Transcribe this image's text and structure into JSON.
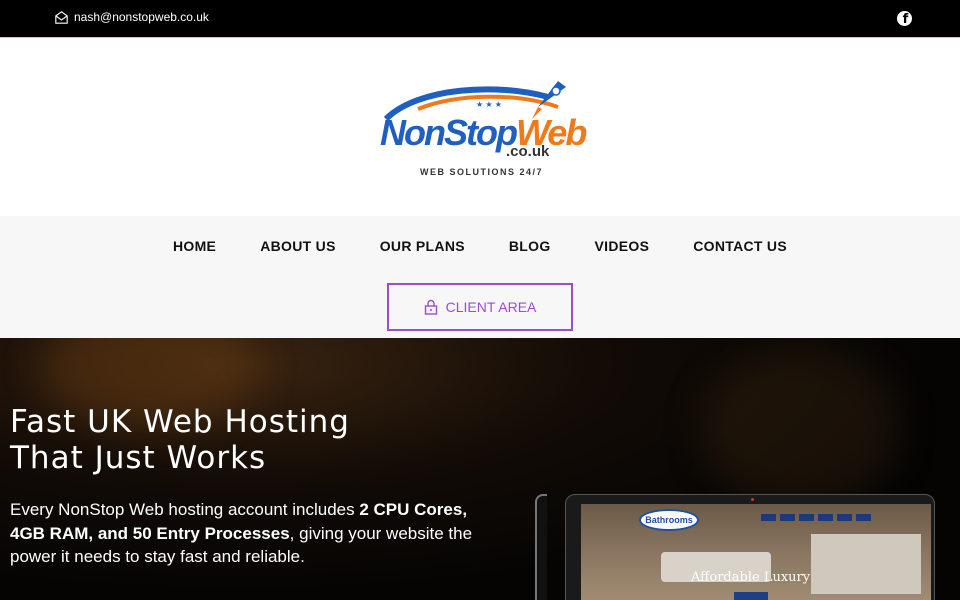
{
  "topbar": {
    "email": "nash@nonstopweb.co.uk",
    "email_icon": "envelope-icon",
    "social_icon": "facebook-icon"
  },
  "logo": {
    "name_part1": "NonStop",
    "name_part2": "Web",
    "domain": ".co.uk",
    "tagline": "WEB SOLUTIONS 24/7",
    "brand_blue": "#1e5fbf",
    "brand_orange": "#f07a1a"
  },
  "nav": {
    "items": [
      {
        "label": "HOME"
      },
      {
        "label": "ABOUT US"
      },
      {
        "label": "OUR PLANS"
      },
      {
        "label": "BLOG"
      },
      {
        "label": "VIDEOS"
      },
      {
        "label": "CONTACT US"
      }
    ],
    "client_area": {
      "label": "CLIENT AREA",
      "icon": "lock-icon",
      "color": "#9b4dd1"
    }
  },
  "hero": {
    "title_line1": "Fast UK Web Hosting",
    "title_line2": "That Just Works",
    "desc_part1": "Every NonStop Web hosting account includes ",
    "desc_bold": "2 CPU Cores, 4GB RAM, and 50 Entry Processes",
    "desc_part2": ", giving your website the power it needs to stay fast and reliable.",
    "screen_badge": "Bathrooms",
    "screen_caption": "Affordable Luxury"
  }
}
